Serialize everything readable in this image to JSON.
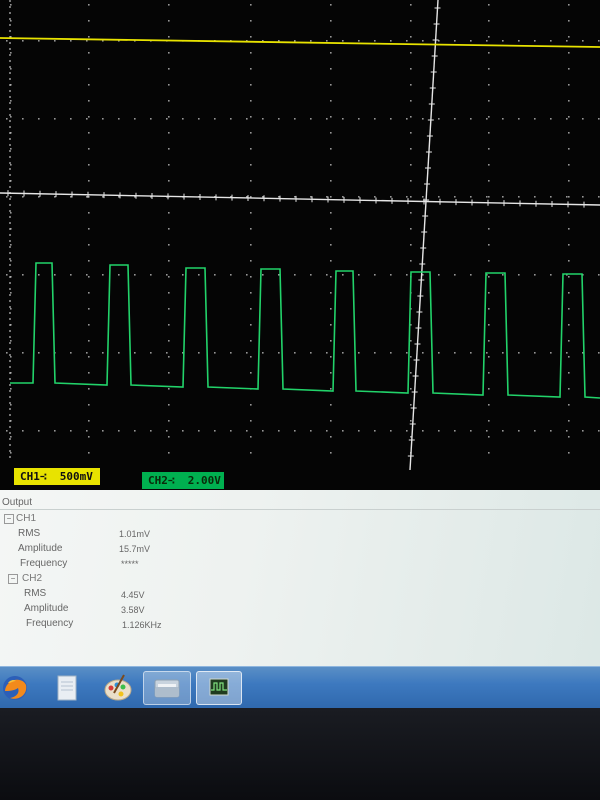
{
  "scope": {
    "ch1_label": "CH1∹  500mV",
    "ch2_label": "CH2∹  2.00V",
    "colors": {
      "ch1": "#e8e300",
      "ch2": "#22d36a",
      "grid": "#c8c8c8"
    }
  },
  "output": {
    "title": "Output",
    "groups": [
      {
        "name": "CH1",
        "rows": [
          {
            "label": "RMS",
            "value": "1.01mV"
          },
          {
            "label": "Amplitude",
            "value": "15.7mV"
          },
          {
            "label": "Frequency",
            "value": "*****"
          }
        ]
      },
      {
        "name": "CH2",
        "rows": [
          {
            "label": "RMS",
            "value": "4.45V"
          },
          {
            "label": "Amplitude",
            "value": "3.58V"
          },
          {
            "label": "Frequency",
            "value": "1.126KHz"
          }
        ]
      }
    ]
  },
  "taskbar": {
    "items": [
      {
        "icon": "firefox-icon"
      },
      {
        "icon": "document-icon"
      },
      {
        "icon": "paint-icon"
      },
      {
        "icon": "folder-icon"
      },
      {
        "icon": "scope-app-icon"
      }
    ]
  }
}
